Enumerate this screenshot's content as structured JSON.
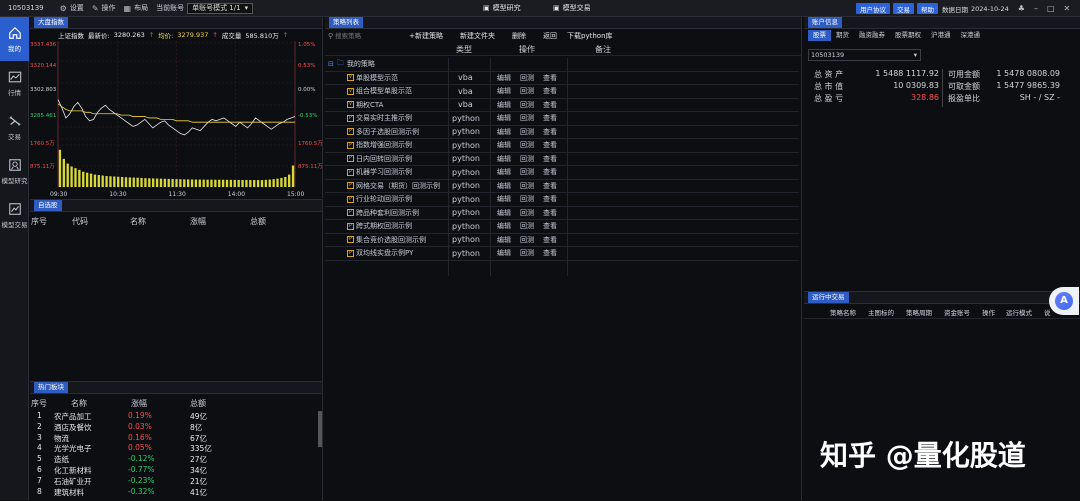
{
  "topbar": {
    "account": "10503139",
    "settings": "设置",
    "operate": "操作",
    "layout": "布局",
    "current_account_label": "当前账号",
    "mode": "单账号模式 1/1",
    "tab_research": "模型研究",
    "tab_trade": "模型交易",
    "btn_agreement": "用户协议",
    "btn_trade": "交易",
    "btn_help": "帮助",
    "data_date_label": "数据日期",
    "data_date": "2024-10-24"
  },
  "nav": [
    {
      "label": "我的"
    },
    {
      "label": "行情"
    },
    {
      "label": "交易"
    },
    {
      "label": "模型研究"
    },
    {
      "label": "模型交易"
    }
  ],
  "index_panel": {
    "tab": "大盘指数",
    "name": "上证指数",
    "latest_label": "最新价:",
    "latest": "3280.263",
    "avg_label": "均价:",
    "avg": "3279.937",
    "vol_label": "成交量",
    "vol": "585.810万"
  },
  "chart_data": {
    "type": "line",
    "title": "",
    "y_left_ticks": [
      "3337.436",
      "3320.144",
      "3302.803",
      "3285.461",
      "1760.5万",
      "875.11万"
    ],
    "y_right_ticks": [
      "1.05%",
      "0.53%",
      "0.00%",
      "-0.53%",
      "1760.5万",
      "875.11万"
    ],
    "x_ticks": [
      "09:30",
      "10:30",
      "11:30",
      "14:00",
      "15:00"
    ],
    "ylim": [
      3268.12,
      3337.436
    ],
    "price": [
      3296,
      3290,
      3283,
      3286,
      3291,
      3294,
      3290,
      3284,
      3281,
      3282,
      3287,
      3290,
      3292,
      3289,
      3287,
      3285,
      3283,
      3281,
      3279,
      3277,
      3278,
      3280,
      3282,
      3279,
      3276,
      3278,
      3280,
      3281,
      3278,
      3276,
      3274,
      3272,
      3271,
      3273,
      3276,
      3275,
      3274,
      3277,
      3280,
      3282,
      3281,
      3282,
      3283,
      3281,
      3279,
      3277,
      3280,
      3278,
      3276,
      3279,
      3283,
      3281,
      3279,
      3277,
      3275,
      3277,
      3279,
      3280,
      3282,
      3283,
      3284
    ],
    "avg_line": [
      3293,
      3291,
      3289,
      3288,
      3288,
      3288,
      3288,
      3287,
      3287,
      3286,
      3286,
      3286,
      3286,
      3286,
      3286,
      3286,
      3285,
      3285,
      3285,
      3284,
      3284,
      3284,
      3284,
      3283,
      3283,
      3283,
      3282,
      3282,
      3282,
      3282,
      3281,
      3281,
      3281,
      3281,
      3280,
      3280,
      3280,
      3280,
      3280,
      3280,
      3280,
      3280,
      3280,
      3280,
      3280,
      3280,
      3280,
      3280,
      3280,
      3280,
      3280,
      3280,
      3280,
      3280,
      3280,
      3280,
      3280,
      3280,
      3280,
      3280,
      3280
    ],
    "volume_ylim": [
      0,
      1760.5
    ],
    "volume": [
      1560,
      1180,
      980,
      860,
      790,
      720,
      640,
      600,
      560,
      520,
      500,
      480,
      460,
      450,
      440,
      430,
      420,
      410,
      400,
      395,
      390,
      380,
      370,
      365,
      360,
      355,
      350,
      345,
      340,
      335,
      330,
      325,
      320,
      318,
      316,
      314,
      312,
      310,
      308,
      306,
      305,
      304,
      303,
      302,
      300,
      298,
      296,
      295,
      294,
      293,
      292,
      291,
      290,
      300,
      310,
      330,
      350,
      380,
      420,
      520,
      900
    ]
  },
  "watch_panel": {
    "tab": "自选股",
    "cols": [
      "序号",
      "代码",
      "名称",
      "涨幅",
      "总额"
    ]
  },
  "hot_panel": {
    "tab": "热门板块",
    "cols": [
      "序号",
      "名称",
      "涨幅",
      "总额"
    ],
    "rows": [
      {
        "no": "1",
        "name": "农产品加工",
        "chg": "0.19%",
        "amt": "49亿",
        "up": true
      },
      {
        "no": "2",
        "name": "酒店及餐饮",
        "chg": "0.03%",
        "amt": "8亿",
        "up": true
      },
      {
        "no": "3",
        "name": "物流",
        "chg": "0.16%",
        "amt": "67亿",
        "up": true
      },
      {
        "no": "4",
        "name": "光学光电子",
        "chg": "0.05%",
        "amt": "335亿",
        "up": true
      },
      {
        "no": "5",
        "name": "造纸",
        "chg": "-0.12%",
        "amt": "27亿",
        "up": false
      },
      {
        "no": "6",
        "name": "化工新材料",
        "chg": "-0.77%",
        "amt": "34亿",
        "up": false
      },
      {
        "no": "7",
        "name": "石油矿业开",
        "chg": "-0.23%",
        "amt": "21亿",
        "up": false
      },
      {
        "no": "8",
        "name": "建筑材料",
        "chg": "-0.32%",
        "amt": "41亿",
        "up": false
      }
    ]
  },
  "strategy_panel": {
    "tab": "策略列表",
    "search_placeholder": "搜索策略",
    "new_strategy": "+新建策略",
    "new_folder": "新建文件夹",
    "delete": "删除",
    "back": "返回",
    "download": "下载python库",
    "cols": [
      "类型",
      "操作",
      "备注"
    ],
    "root": "我的策略",
    "rows": [
      {
        "name": "单股模型示范",
        "type": "vba",
        "icon": "V"
      },
      {
        "name": "组合模型单股示范",
        "type": "vba",
        "icon": "V"
      },
      {
        "name": "期权CTA",
        "type": "vba",
        "icon": "V"
      },
      {
        "name": "交易实时主推示例",
        "type": "python",
        "icon": "P"
      },
      {
        "name": "多因子选股回测示例",
        "type": "python",
        "icon": "P"
      },
      {
        "name": "指数增强回测示例",
        "type": "python",
        "icon": "P"
      },
      {
        "name": "日内回转回测示例",
        "type": "python",
        "icon": "P"
      },
      {
        "name": "机器学习回测示例",
        "type": "python",
        "icon": "P"
      },
      {
        "name": "网格交易（期货）回测示例",
        "type": "python",
        "icon": "P"
      },
      {
        "name": "行业轮动回测示例",
        "type": "python",
        "icon": "P"
      },
      {
        "name": "跨品种套利回测示例",
        "type": "python",
        "icon": "P"
      },
      {
        "name": "跨式期权回测示例",
        "type": "python",
        "icon": "P"
      },
      {
        "name": "集合竞价选股回测示例",
        "type": "python",
        "icon": "P"
      },
      {
        "name": "双均线实盘示例PY",
        "type": "python",
        "icon": "P"
      }
    ],
    "op_edit": "编辑",
    "op_backtest": "回测",
    "op_view": "查看"
  },
  "account_panel": {
    "tab": "账户信息",
    "tabs": [
      "股票",
      "期货",
      "融资融券",
      "股票期权",
      "沪港通",
      "深港通"
    ],
    "account": "10503139",
    "total_assets_label": "总 资 产",
    "total_assets": "1 5488 1117.92",
    "available_label": "可用金额",
    "available": "1 5478 0808.09",
    "market_value_label": "总 市 值",
    "market_value": "10 0309.83",
    "withdrawable_label": "可取金额",
    "withdrawable": "1 5477 9865.39",
    "pnl_label": "总 盈 亏",
    "pnl": "328.86",
    "ratio_label": "报盈单比",
    "ratio": "SH - / SZ -"
  },
  "running_panel": {
    "tab": "运行中交易",
    "cols": [
      "策略名称",
      "主图标的",
      "策略周期",
      "资金账号",
      "操作",
      "运行模式",
      "说"
    ]
  },
  "watermark": "知乎 @量化股道"
}
